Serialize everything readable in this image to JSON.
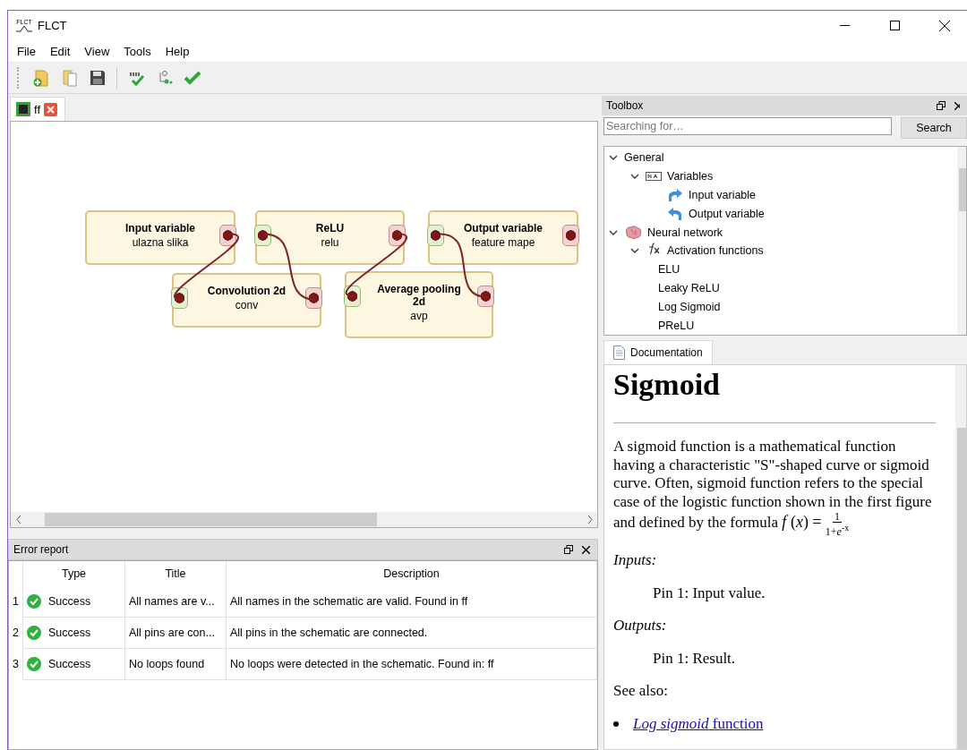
{
  "window": {
    "title": "FLCT",
    "logo": "FLCT"
  },
  "menu": [
    "File",
    "Edit",
    "View",
    "Tools",
    "Help"
  ],
  "editor_tabs": [
    {
      "label": "ff",
      "selected": true
    }
  ],
  "schematic": {
    "nodes": [
      {
        "title": "Input variable",
        "subtitle": "ulazna slika"
      },
      {
        "title": "ReLU",
        "subtitle": "relu"
      },
      {
        "title": "Output variable",
        "subtitle": "feature mape"
      },
      {
        "title": "Convolution 2d",
        "subtitle": "conv"
      },
      {
        "title": "Average pooling 2d",
        "subtitle": "avp"
      }
    ]
  },
  "error_report": {
    "title": "Error report",
    "columns": [
      "Type",
      "Title",
      "Description"
    ],
    "rows": [
      {
        "number": "1",
        "kind": "success",
        "type": "Success",
        "title": "All names are v...",
        "description": "All names in the schematic are valid. Found in ff"
      },
      {
        "number": "2",
        "kind": "success",
        "type": "Success",
        "title": "All pins are con...",
        "description": "All pins in the schematic are connected."
      },
      {
        "number": "3",
        "kind": "success",
        "type": "Success",
        "title": "No loops found",
        "description": "No loops were detected in the schematic. Found in: ff"
      }
    ]
  },
  "toolbox": {
    "title": "Toolbox",
    "search": {
      "placeholder": "Searching for…",
      "button": "Search"
    },
    "tree": [
      {
        "label": "General",
        "kind": "plain",
        "expanded": true,
        "children": [
          {
            "label": "Variables",
            "kind": "variables",
            "expanded": true,
            "children": [
              {
                "label": "Input variable",
                "kind": "input"
              },
              {
                "label": "Output variable",
                "kind": "output"
              }
            ]
          }
        ]
      },
      {
        "label": "Neural network",
        "kind": "network",
        "expanded": true,
        "children": [
          {
            "label": "Activation functions",
            "kind": "functions",
            "expanded": true,
            "children": [
              {
                "label": "ELU",
                "kind": "plain"
              },
              {
                "label": "Leaky ReLU",
                "kind": "plain"
              },
              {
                "label": "Log Sigmoid",
                "kind": "plain"
              },
              {
                "label": "PReLU",
                "kind": "plain"
              }
            ]
          }
        ]
      }
    ]
  },
  "documentation": {
    "tab": "Documentation",
    "heading": "Sigmoid",
    "paragraph": "A sigmoid function is a mathematical function having a characteristic \"S\"-shaped curve or sigmoid curve. Often, sigmoid function refers to the special case of the logistic function shown in the first figure and defined by the formula",
    "formula": {
      "lhs": "*f* (*x*) =",
      "numerator": "1",
      "denominator": "1+*e*$^{-x}$"
    },
    "inputs_label": "Inputs:",
    "inputs": [
      "Pin 1: Input value."
    ],
    "outputs_label": "Outputs:",
    "outputs": [
      "Pin 1: Result."
    ],
    "see_also_label": "See also:",
    "links": [
      "*Log sigmoid* function"
    ]
  }
}
